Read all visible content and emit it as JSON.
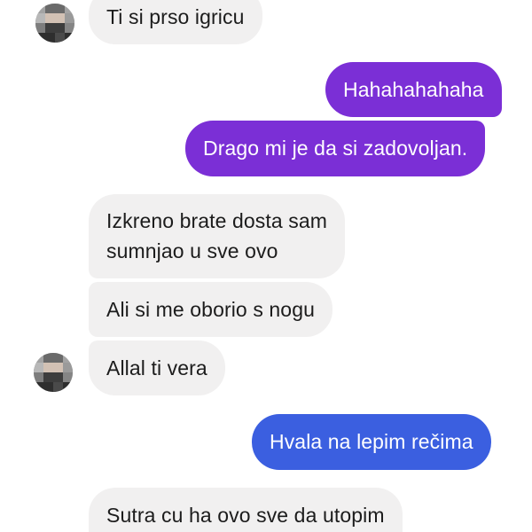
{
  "colors": {
    "incoming_bubble": "#f1f0f0",
    "outgoing_purple": "#7b2fd6",
    "outgoing_blue": "#3b5fe0",
    "text_dark": "#1c1c1c",
    "text_light": "#ffffff"
  },
  "avatar_icon": "pixelated-profile-avatar-icon",
  "messages": [
    {
      "sender": "contact",
      "text": "Ti si prso igricu"
    },
    {
      "sender": "me",
      "text": "Hahahahahaha"
    },
    {
      "sender": "me",
      "text": "Drago mi je da si zadovoljan."
    },
    {
      "sender": "contact",
      "lines": [
        "Izkreno brate dosta sam",
        "sumnjao u sve ovo"
      ]
    },
    {
      "sender": "contact",
      "text": "Ali si me oborio s nogu"
    },
    {
      "sender": "contact",
      "text": "Allal ti vera"
    },
    {
      "sender": "me",
      "text": "Hvala na lepim rečima"
    },
    {
      "sender": "contact",
      "text": "Sutra cu ha ovo sve da utopim"
    }
  ]
}
